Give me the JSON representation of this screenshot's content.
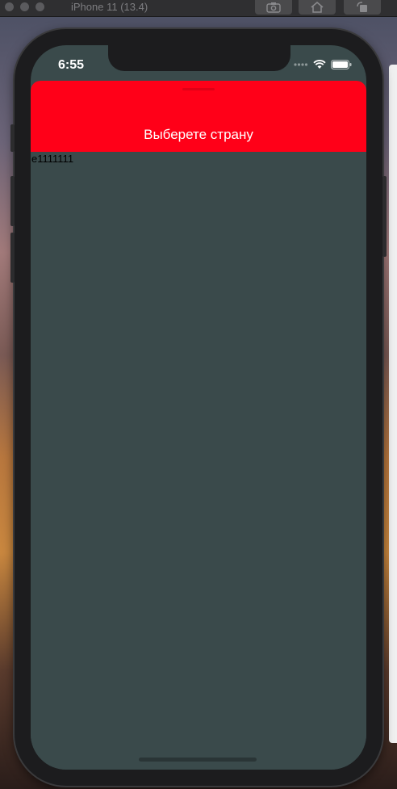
{
  "simulator": {
    "title": "iPhone 11 (13.4)",
    "buttons": [
      "screenshot-icon",
      "home-icon",
      "rotate-icon"
    ]
  },
  "status_bar": {
    "time": "6:55"
  },
  "modal": {
    "title": "Выберете страну",
    "header_color": "#ff0018",
    "background_color": "#3a4a4b"
  },
  "content": {
    "text": "e1111111"
  }
}
